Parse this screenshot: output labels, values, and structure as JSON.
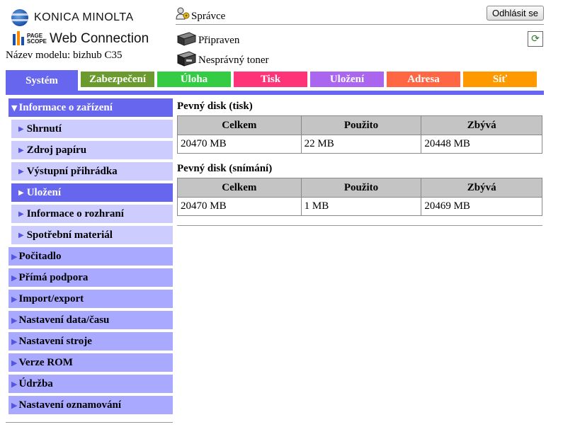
{
  "header": {
    "brand": "KONICA MINOLTA",
    "pagescope_line1": "PAGE",
    "pagescope_line2": "SCOPE",
    "web_connection": "Web Connection",
    "model_label": "Název modelu: bizhub C35",
    "admin_name": "Správce",
    "logout_label": "Odhlásit se",
    "status_ready": "Připraven",
    "status_toner": "Nesprávný toner"
  },
  "tabs": [
    {
      "label": "Systém",
      "color": "#6666ee"
    },
    {
      "label": "Zabezpečení",
      "color": "#6b9b2e"
    },
    {
      "label": "Úloha",
      "color": "#33cc44"
    },
    {
      "label": "Tisk",
      "color": "#ff3377"
    },
    {
      "label": "Uložení",
      "color": "#aa66ee"
    },
    {
      "label": "Adresa",
      "color": "#ff6644"
    },
    {
      "label": "Síť",
      "color": "#ff9900"
    }
  ],
  "sidebar": [
    {
      "label": "Informace o zařízení"
    },
    {
      "label": "Shrnutí"
    },
    {
      "label": "Zdroj papíru"
    },
    {
      "label": "Výstupní přihrádka"
    },
    {
      "label": "Uložení"
    },
    {
      "label": "Informace o rozhraní"
    },
    {
      "label": "Spotřební materiál"
    },
    {
      "label": "Počitadlo"
    },
    {
      "label": "Přímá podpora"
    },
    {
      "label": "Import/export"
    },
    {
      "label": "Nastavení data/času"
    },
    {
      "label": "Nastavení stroje"
    },
    {
      "label": "Verze ROM"
    },
    {
      "label": "Údržba"
    },
    {
      "label": "Nastavení oznamování"
    }
  ],
  "content": {
    "print_disk": {
      "title": "Pevný disk (tisk)",
      "headers": [
        "Celkem",
        "Použito",
        "Zbývá"
      ],
      "row": [
        "20470 MB",
        "22 MB",
        "20448 MB"
      ]
    },
    "scan_disk": {
      "title": "Pevný disk (snímání)",
      "headers": [
        "Celkem",
        "Použito",
        "Zbývá"
      ],
      "row": [
        "20470 MB",
        "1 MB",
        "20469 MB"
      ]
    }
  }
}
